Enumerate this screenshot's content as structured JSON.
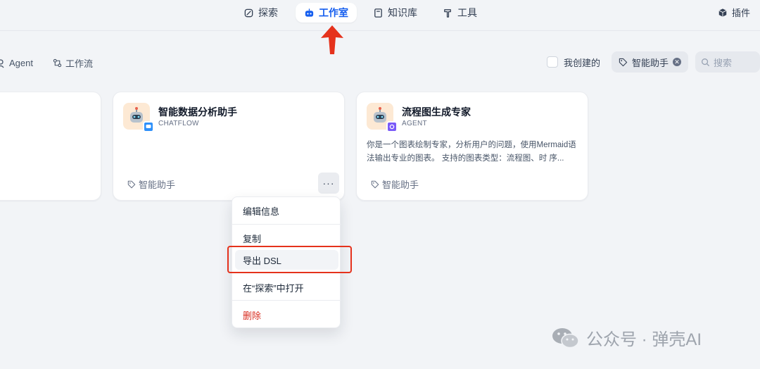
{
  "nav": {
    "items": [
      {
        "label": "探索",
        "icon": "explore-icon"
      },
      {
        "label": "工作室",
        "icon": "robot-icon",
        "active": true
      },
      {
        "label": "知识库",
        "icon": "book-icon"
      },
      {
        "label": "工具",
        "icon": "hammer-icon"
      }
    ],
    "plugin_label": "插件"
  },
  "filters": {
    "agent_label": "Agent",
    "workflow_label": "工作流",
    "created_by_me_label": "我创建的",
    "tag_label": "智能助手",
    "search_placeholder": "搜索"
  },
  "cards": [
    {
      "title": "智能数据分析助手",
      "type": "CHATFLOW",
      "description": "",
      "tag": "智能助手"
    },
    {
      "title": "流程图生成专家",
      "type": "AGENT",
      "description": "你是一个图表绘制专家，分析用户的问题，使用Mermaid语法输出专业的图表。 支持的图表类型：流程图、时 序...",
      "tag": "智能助手"
    }
  ],
  "menu": {
    "more_label": "···",
    "items": [
      {
        "label": "编辑信息"
      },
      {
        "label": "复制"
      },
      {
        "label": "导出 DSL"
      },
      {
        "label": "在“探索”中打开"
      },
      {
        "label": "删除"
      }
    ]
  },
  "watermark": "公众号 · 弹壳AI",
  "colors": {
    "accent": "#155eef",
    "danger": "#d92d20",
    "annotation": "#e5321c"
  }
}
